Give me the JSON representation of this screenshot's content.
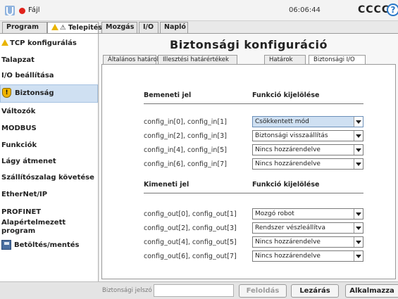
{
  "topbar": {
    "logo_icon": "universal-robots-logo",
    "record_icon": "red-dot",
    "file_menu": "Fájl",
    "time": "06:06:44",
    "robot_name": "CCCC",
    "help_icon": "?"
  },
  "main_tabs": [
    {
      "label": "Program"
    },
    {
      "label": "⚠ Telepités"
    },
    {
      "label": "Mozgás"
    },
    {
      "label": "I/O"
    },
    {
      "label": "Napló"
    }
  ],
  "sidebar": {
    "items": [
      {
        "label": "TCP konfigurálás"
      },
      {
        "label": "Talapzat"
      },
      {
        "label": "I/O beállítása"
      },
      {
        "label": "Biztonság"
      },
      {
        "label": "Változók"
      },
      {
        "label": "MODBUS"
      },
      {
        "label": "Funkciók"
      },
      {
        "label": "Lágy átmenet"
      },
      {
        "label": "Szállítószalag követése"
      },
      {
        "label": "EtherNet/IP"
      },
      {
        "label": "PROFINET"
      },
      {
        "label": "Alapértelmezett program"
      },
      {
        "label": "Betöltés/mentés"
      }
    ]
  },
  "page": {
    "title": "Biztonsági konfiguráció",
    "subtabs": [
      {
        "label": "Általános határok"
      },
      {
        "label": "Illesztési határértékek"
      },
      {
        "label": "Határok"
      },
      {
        "label": "Biztonsági I/O"
      }
    ]
  },
  "inputs": {
    "header_signal": "Bemeneti jel",
    "header_function": "Funkció kijelölése",
    "rows": [
      {
        "signal": "config_in[0], config_in[1]",
        "function": "Csökkentett mód"
      },
      {
        "signal": "config_in[2], config_in[3]",
        "function": "Biztonsági visszaállítás"
      },
      {
        "signal": "config_in[4], config_in[5]",
        "function": "Nincs hozzárendelve"
      },
      {
        "signal": "config_in[6], config_in[7]",
        "function": "Nincs hozzárendelve"
      }
    ]
  },
  "outputs": {
    "header_signal": "Kimeneti jel",
    "header_function": "Funkció kijelölése",
    "rows": [
      {
        "signal": "config_out[0], config_out[1]",
        "function": "Mozgó robot"
      },
      {
        "signal": "config_out[2], config_out[3]",
        "function": "Rendszer vészleállítva"
      },
      {
        "signal": "config_out[4], config_out[5]",
        "function": "Nincs hozzárendelve"
      },
      {
        "signal": "config_out[6], config_out[7]",
        "function": "Nincs hozzárendelve"
      }
    ]
  },
  "bottombar": {
    "password_label": "Biztonsági jelszó",
    "password_value": "",
    "unlock_button": "Feloldás",
    "lock_button": "Lezárás",
    "apply_button": "Alkalmazza"
  },
  "colors": {
    "selection": "#cfe0f2",
    "warning": "#e9b400",
    "record": "#e0221b",
    "help": "#2a78c8"
  }
}
